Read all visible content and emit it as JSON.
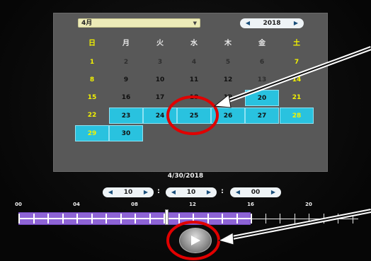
{
  "calendar": {
    "month": "4月",
    "year": "2018",
    "weekdays": [
      "日",
      "月",
      "火",
      "水",
      "木",
      "金",
      "土"
    ],
    "days": [
      {
        "d": "1",
        "col": 0,
        "row": 0,
        "state": "dim",
        "weekend": true
      },
      {
        "d": "2",
        "col": 1,
        "row": 0,
        "state": "dim"
      },
      {
        "d": "3",
        "col": 2,
        "row": 0,
        "state": "dim"
      },
      {
        "d": "4",
        "col": 3,
        "row": 0,
        "state": "dim"
      },
      {
        "d": "5",
        "col": 4,
        "row": 0,
        "state": "dim"
      },
      {
        "d": "6",
        "col": 5,
        "row": 0,
        "state": "dim"
      },
      {
        "d": "7",
        "col": 6,
        "row": 0,
        "state": "dim",
        "weekend": true
      },
      {
        "d": "8",
        "col": 0,
        "row": 1,
        "state": "dim",
        "weekend": true
      },
      {
        "d": "9",
        "col": 1,
        "row": 1,
        "state": "dark"
      },
      {
        "d": "10",
        "col": 2,
        "row": 1,
        "state": "dark"
      },
      {
        "d": "11",
        "col": 3,
        "row": 1,
        "state": "dark"
      },
      {
        "d": "12",
        "col": 4,
        "row": 1,
        "state": "dark"
      },
      {
        "d": "13",
        "col": 5,
        "row": 1,
        "state": "dim"
      },
      {
        "d": "14",
        "col": 6,
        "row": 1,
        "state": "dim",
        "weekend": true
      },
      {
        "d": "15",
        "col": 0,
        "row": 2,
        "state": "dark",
        "weekend": true
      },
      {
        "d": "16",
        "col": 1,
        "row": 2,
        "state": "dark"
      },
      {
        "d": "17",
        "col": 2,
        "row": 2,
        "state": "dark"
      },
      {
        "d": "18",
        "col": 3,
        "row": 2,
        "state": "dark"
      },
      {
        "d": "19",
        "col": 4,
        "row": 2,
        "state": "dark"
      },
      {
        "d": "20",
        "col": 5,
        "row": 2,
        "state": "avail"
      },
      {
        "d": "21",
        "col": 6,
        "row": 2,
        "state": "dark",
        "weekend": true
      },
      {
        "d": "22",
        "col": 0,
        "row": 3,
        "state": "dark",
        "weekend": true
      },
      {
        "d": "23",
        "col": 1,
        "row": 3,
        "state": "avail"
      },
      {
        "d": "24",
        "col": 2,
        "row": 3,
        "state": "avail"
      },
      {
        "d": "25",
        "col": 3,
        "row": 3,
        "state": "avail"
      },
      {
        "d": "26",
        "col": 4,
        "row": 3,
        "state": "avail"
      },
      {
        "d": "27",
        "col": 5,
        "row": 3,
        "state": "avail"
      },
      {
        "d": "28",
        "col": 6,
        "row": 3,
        "state": "avail",
        "weekend": true
      },
      {
        "d": "29",
        "col": 0,
        "row": 4,
        "state": "avail",
        "weekend": true
      },
      {
        "d": "30",
        "col": 1,
        "row": 4,
        "state": "avail"
      }
    ]
  },
  "selected_date": "4/30/2018",
  "time": {
    "hour": "10",
    "minute": "10",
    "second": "00",
    "separator": ":"
  },
  "timeline": {
    "ticks": [
      "00",
      "04",
      "08",
      "12",
      "16",
      "20"
    ],
    "recorded_until_hour": 16,
    "cursor_hour": 10.1
  },
  "colors": {
    "available_day": "#29c2df",
    "weekend_text": "#f2f200",
    "timeline_fill": "#8e64d6",
    "annotation": "#e10000"
  }
}
